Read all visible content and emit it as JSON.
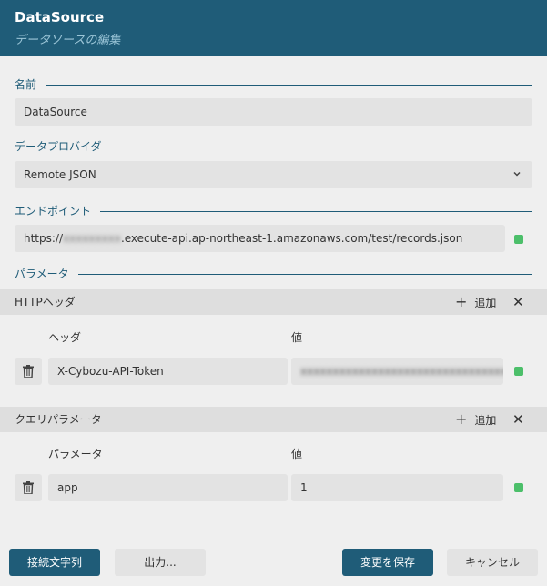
{
  "header": {
    "title": "DataSource",
    "subtitle": "データソースの編集"
  },
  "name_section": {
    "label": "名前",
    "value": "DataSource"
  },
  "provider_section": {
    "label": "データプロバイダ",
    "selected": "Remote JSON"
  },
  "endpoint_section": {
    "label": "エンドポイント",
    "prefix": "https://",
    "blurred_fragment": "xxxxxxxxx",
    "suffix": ".execute-api.ap-northeast-1.amazonaws.com/test/records.json"
  },
  "params_section": {
    "label": "パラメータ"
  },
  "http_headers": {
    "title": "HTTPヘッダ",
    "add_label": "追加",
    "col_header": "ヘッダ",
    "col_value": "値",
    "rows": [
      {
        "header": "X-Cybozu-API-Token",
        "value": "xxxxxxxxxxxxxxxxxxxxxxxxxxxxxxxx"
      }
    ]
  },
  "query_params": {
    "title": "クエリパラメータ",
    "add_label": "追加",
    "col_param": "パラメータ",
    "col_value": "値",
    "rows": [
      {
        "param": "app",
        "value": "1"
      }
    ]
  },
  "footer": {
    "connection_string": "接続文字列",
    "output": "出力...",
    "save": "変更を保存",
    "cancel": "キャンセル"
  },
  "colors": {
    "accent": "#1f5c78",
    "status_ok": "#4cbf6a"
  }
}
